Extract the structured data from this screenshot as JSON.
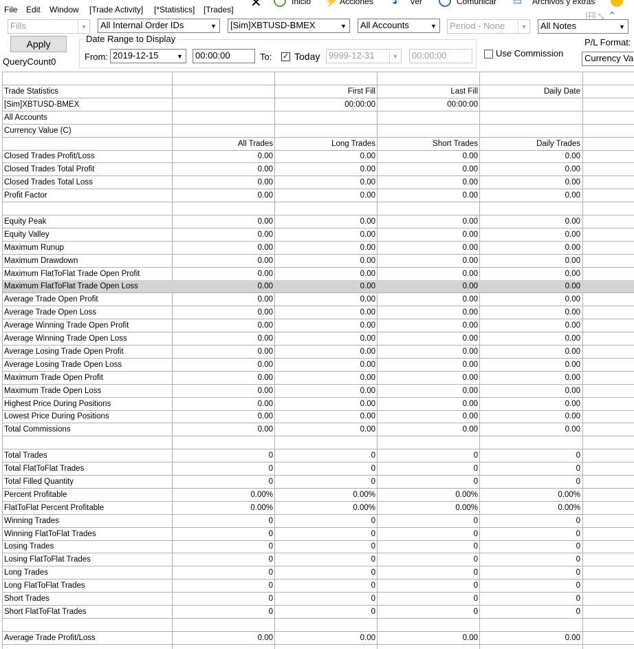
{
  "menu": [
    "File",
    "Edit",
    "Window",
    "[Trade Activity]",
    "[*Statistics]",
    "[Trades]"
  ],
  "overlay_menu": [
    "Inicio",
    "Acciones",
    "Ver",
    "Comunicar",
    "Archivos y extras"
  ],
  "toolbar": {
    "fills": "Fills",
    "order_ids": "All Internal Order IDs",
    "symbol": "[Sim]XBTUSD-BMEX",
    "accounts": "All Accounts",
    "period": "Period - None",
    "notes": "All Notes",
    "apply": "Apply",
    "query_count": "QueryCount0",
    "date_range_title": "Date Range to Display",
    "from_label": "From:",
    "from_date": "2019-12-15",
    "from_time": "00:00:00",
    "to_label": "To:",
    "today_label": "Today",
    "today_checked": "✓",
    "to_date": "9999-12-31",
    "to_time": "00:00:00",
    "use_commission": "Use Commission",
    "pl_format_label": "P/L Format:",
    "pl_format_value": "Currency Value"
  },
  "grid": {
    "rows": [
      {
        "c": [
          "",
          "",
          "",
          "",
          ""
        ]
      },
      {
        "c": [
          "Trade Statistics",
          "",
          "First Fill",
          "Last Fill",
          "Daily Date"
        ]
      },
      {
        "c": [
          "[Sim]XBTUSD-BMEX",
          "",
          "00:00:00",
          "00:00:00",
          ""
        ]
      },
      {
        "c": [
          "All Accounts",
          "",
          "",
          "",
          ""
        ]
      },
      {
        "c": [
          "Currency Value (C)",
          "",
          "",
          "",
          ""
        ]
      },
      {
        "c": [
          "",
          "All Trades",
          "Long Trades",
          "Short Trades",
          "Daily Trades"
        ]
      },
      {
        "c": [
          "Closed Trades Profit/Loss",
          "0.00",
          "0.00",
          "0.00",
          "0.00"
        ]
      },
      {
        "c": [
          "Closed Trades Total Profit",
          "0.00",
          "0.00",
          "0.00",
          "0.00"
        ]
      },
      {
        "c": [
          "Closed Trades Total Loss",
          "0.00",
          "0.00",
          "0.00",
          "0.00"
        ]
      },
      {
        "c": [
          "Profit Factor",
          "0.00",
          "0.00",
          "0.00",
          "0.00"
        ]
      },
      {
        "c": [
          "",
          "",
          "",
          "",
          ""
        ]
      },
      {
        "c": [
          "Equity Peak",
          "0.00",
          "0.00",
          "0.00",
          "0.00"
        ]
      },
      {
        "c": [
          "Equity Valley",
          "0.00",
          "0.00",
          "0.00",
          "0.00"
        ]
      },
      {
        "c": [
          "Maximum Runup",
          "0.00",
          "0.00",
          "0.00",
          "0.00"
        ]
      },
      {
        "c": [
          "Maximum Drawdown",
          "0.00",
          "0.00",
          "0.00",
          "0.00"
        ]
      },
      {
        "c": [
          "Maximum FlatToFlat Trade Open Profit",
          "0.00",
          "0.00",
          "0.00",
          "0.00"
        ]
      },
      {
        "c": [
          "Maximum FlatToFlat Trade Open Loss",
          "0.00",
          "0.00",
          "0.00",
          "0.00"
        ],
        "hl": true
      },
      {
        "c": [
          "Average Trade Open Profit",
          "0.00",
          "0.00",
          "0.00",
          "0.00"
        ]
      },
      {
        "c": [
          "Average Trade Open Loss",
          "0.00",
          "0.00",
          "0.00",
          "0.00"
        ]
      },
      {
        "c": [
          "Average Winning Trade Open Profit",
          "0.00",
          "0.00",
          "0.00",
          "0.00"
        ]
      },
      {
        "c": [
          "Average Winning Trade Open Loss",
          "0.00",
          "0.00",
          "0.00",
          "0.00"
        ]
      },
      {
        "c": [
          "Average Losing Trade Open Profit",
          "0.00",
          "0.00",
          "0.00",
          "0.00"
        ]
      },
      {
        "c": [
          "Average Losing Trade Open Loss",
          "0.00",
          "0.00",
          "0.00",
          "0.00"
        ]
      },
      {
        "c": [
          "Maximum Trade Open Profit",
          "0.00",
          "0.00",
          "0.00",
          "0.00"
        ]
      },
      {
        "c": [
          "Maximum Trade Open Loss",
          "0.00",
          "0.00",
          "0.00",
          "0.00"
        ]
      },
      {
        "c": [
          "Highest Price During Positions",
          "0.00",
          "0.00",
          "0.00",
          "0.00"
        ]
      },
      {
        "c": [
          "Lowest Price During Positions",
          "0.00",
          "0.00",
          "0.00",
          "0.00"
        ]
      },
      {
        "c": [
          "Total Commissions",
          "0.00",
          "0.00",
          "0.00",
          "0.00"
        ]
      },
      {
        "c": [
          "",
          "",
          "",
          "",
          ""
        ]
      },
      {
        "c": [
          "Total Trades",
          "0",
          "0",
          "0",
          "0"
        ]
      },
      {
        "c": [
          "Total FlatToFlat Trades",
          "0",
          "0",
          "0",
          "0"
        ]
      },
      {
        "c": [
          "Total Filled Quantity",
          "0",
          "0",
          "0",
          "0"
        ]
      },
      {
        "c": [
          "Percent Profitable",
          "0.00%",
          "0.00%",
          "0.00%",
          "0.00%"
        ]
      },
      {
        "c": [
          "FlatToFlat Percent Profitable",
          "0.00%",
          "0.00%",
          "0.00%",
          "0.00%"
        ]
      },
      {
        "c": [
          "Winning Trades",
          "0",
          "0",
          "0",
          "0"
        ]
      },
      {
        "c": [
          "Winning FlatToFlat Trades",
          "0",
          "0",
          "0",
          "0"
        ]
      },
      {
        "c": [
          "Losing Trades",
          "0",
          "0",
          "0",
          "0"
        ]
      },
      {
        "c": [
          "Losing FlatToFlat Trades",
          "0",
          "0",
          "0",
          "0"
        ]
      },
      {
        "c": [
          "Long Trades",
          "0",
          "0",
          "0",
          "0"
        ]
      },
      {
        "c": [
          "Long FlatToFlat Trades",
          "0",
          "0",
          "0",
          "0"
        ]
      },
      {
        "c": [
          "Short Trades",
          "0",
          "0",
          "0",
          "0"
        ]
      },
      {
        "c": [
          "Short FlatToFlat Trades",
          "0",
          "0",
          "0",
          "0"
        ]
      },
      {
        "c": [
          "",
          "",
          "",
          "",
          ""
        ]
      },
      {
        "c": [
          "Average Trade Profit/Loss",
          "0.00",
          "0.00",
          "0.00",
          "0.00"
        ]
      }
    ]
  },
  "colors": {
    "highlight_row": "#d3d3d3",
    "grid_line": "#b0b0b0",
    "disabled_text": "#a0a0a0"
  }
}
